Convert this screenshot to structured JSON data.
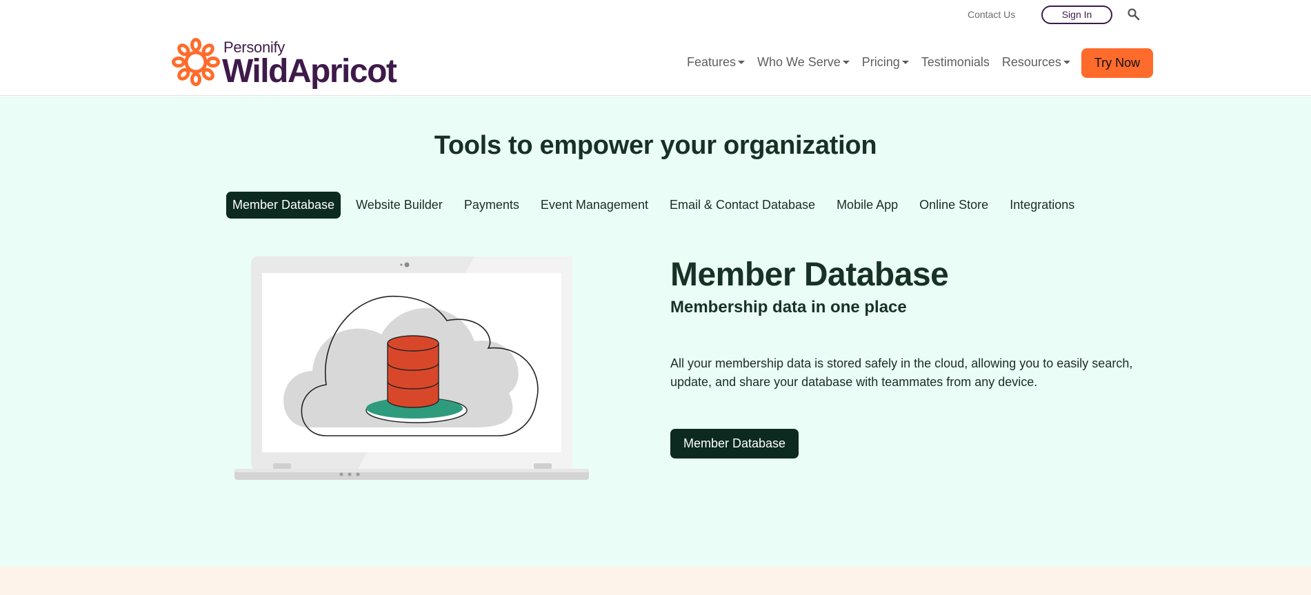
{
  "utility": {
    "contact_label": "Contact Us",
    "signin_label": "Sign In",
    "search_icon": "search-icon"
  },
  "logo": {
    "small": "Personify",
    "big": "WildApricot"
  },
  "nav": {
    "items": [
      {
        "label": "Features",
        "dropdown": true
      },
      {
        "label": "Who We Serve",
        "dropdown": true
      },
      {
        "label": "Pricing",
        "dropdown": true
      },
      {
        "label": "Testimonials",
        "dropdown": false
      },
      {
        "label": "Resources",
        "dropdown": true
      }
    ],
    "cta_label": "Try Now"
  },
  "main": {
    "title": "Tools to empower your organization",
    "tabs": [
      {
        "label": "Member Database",
        "active": true
      },
      {
        "label": "Website Builder",
        "active": false
      },
      {
        "label": "Payments",
        "active": false
      },
      {
        "label": "Event Management",
        "active": false
      },
      {
        "label": "Email & Contact Database",
        "active": false
      },
      {
        "label": "Mobile App",
        "active": false
      },
      {
        "label": "Online Store",
        "active": false
      },
      {
        "label": "Integrations",
        "active": false
      }
    ],
    "content": {
      "heading": "Member Database",
      "subheading": "Membership data in one place",
      "body": "All your membership data is stored safely in the cloud, allowing you to easily search, update, and share your database with teammates from any device.",
      "button_label": "Member Database"
    }
  },
  "colors": {
    "brand_orange": "#ff6b2b",
    "brand_purple": "#3e1a4a",
    "dark_green": "#0c2a1f",
    "mint_bg": "#eafdf6",
    "peach_bg": "#fdf3ea",
    "db_red": "#d9472b",
    "db_teal": "#2f9b7d"
  }
}
